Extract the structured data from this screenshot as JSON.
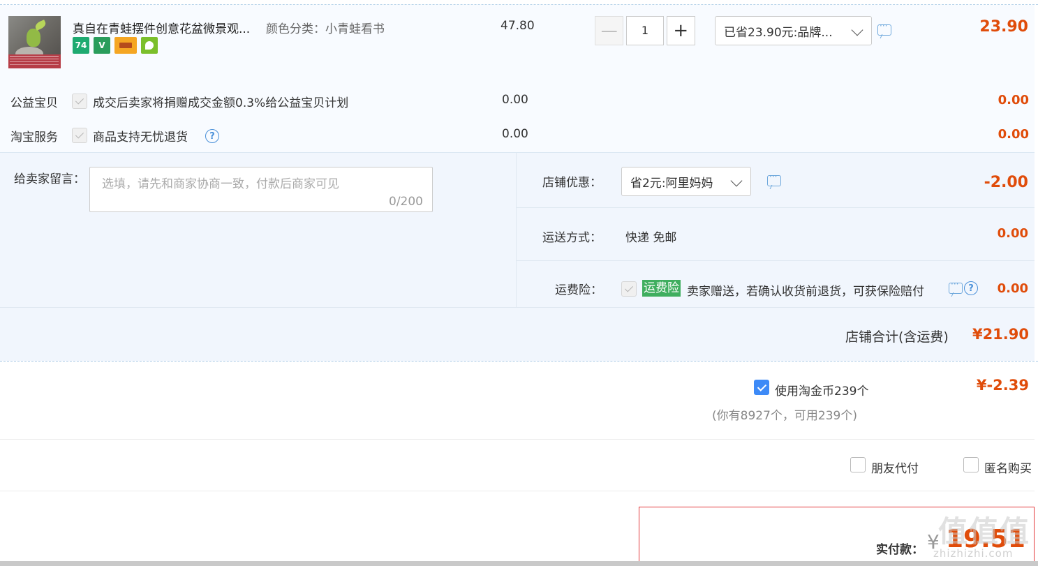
{
  "item": {
    "title": "真自在青蛙摆件创意花盆微景观...",
    "spec": "颜色分类：小青蛙看书",
    "badges": [
      "74",
      "V",
      "card",
      "leaf"
    ],
    "price": "47.80",
    "quantity": "1",
    "minus_symbol": "—",
    "plus_symbol": "+",
    "promo_select": "已省23.90元:品牌...",
    "subtotal": "23.90"
  },
  "services": [
    {
      "category": "公益宝贝",
      "description": "成交后卖家将捐赠成交金额0.3%给公益宝贝计划",
      "price": "0.00",
      "amount": "0.00"
    },
    {
      "category": "淘宝服务",
      "description": "商品支持无忧退货",
      "help": "?",
      "price": "0.00",
      "amount": "0.00"
    }
  ],
  "message": {
    "label": "给卖家留言：",
    "placeholder": "选填，请先和商家协商一致，付款后商家可见",
    "counter": "0/200"
  },
  "shop": {
    "discount_label": "店铺优惠：",
    "discount_select": "省2元:阿里妈妈",
    "discount_amount": "-2.00",
    "shipping_label": "运送方式：",
    "shipping_value": "快递 免邮",
    "shipping_amount": "0.00",
    "insurance_label": "运费险：",
    "insurance_tag": "运费险",
    "insurance_desc": "卖家赠送，若确认收货前退货，可获保险赔付",
    "insurance_help": "?",
    "insurance_amount": "0.00",
    "total_label": "店铺合计(含运费)",
    "total_amount": "¥21.90"
  },
  "coins": {
    "label": "使用淘金币239个",
    "detail": "(你有8927个，可用239个)",
    "amount": "¥-2.39"
  },
  "options": {
    "friend_pay": "朋友代付",
    "anonymous": "匿名购买"
  },
  "payment": {
    "label": "实付款：",
    "currency": "¥",
    "amount": "19.51"
  },
  "watermark": {
    "text": "值值值",
    "url": "zhizhizhi.com"
  },
  "colors": {
    "accent": "#e04c0a",
    "link_blue": "#4a90d9",
    "green_tag": "#3fae5f",
    "panel_bg": "#f1f6fd"
  }
}
